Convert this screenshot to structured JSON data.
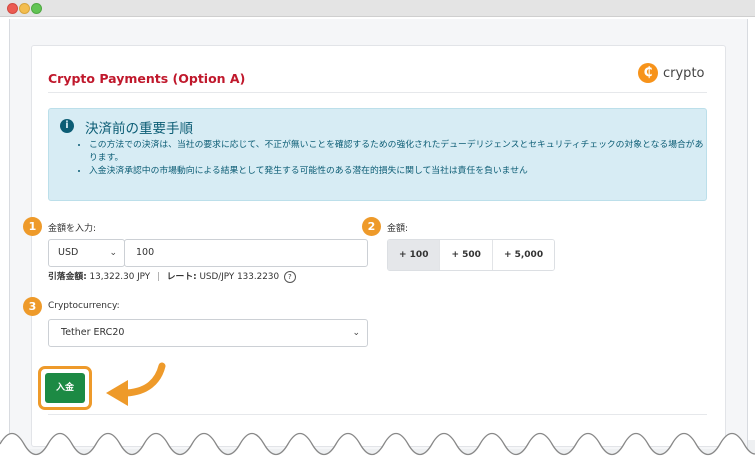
{
  "card": {
    "title": "Crypto Payments (Option A)",
    "brand": {
      "coin_glyph": "₵",
      "text": "crypto"
    }
  },
  "notice": {
    "title": "決済前の重要手順",
    "items": [
      "この方法での決済は、当社の要求に応じて、不正が無いことを確認するための強化されたデューデリジェンスとセキュリティチェックの対象となる場合があります。",
      "入金決済承認中の市場動向による結果として発生する可能性のある潜在的損失に関して当社は責任を負いません"
    ]
  },
  "step1": {
    "number": "1",
    "label": "金額を入力:",
    "currency": "USD",
    "amount": "100",
    "debit_label": "引落金額:",
    "debit_value": "13,322.30 JPY",
    "separator": "|",
    "rate_label": "レート:",
    "rate_value": "USD/JPY 133.2230",
    "help_glyph": "?"
  },
  "step2": {
    "number": "2",
    "label": "金額:",
    "buttons": [
      "+ 100",
      "+ 500",
      "+ 5,000"
    ]
  },
  "step3": {
    "number": "3",
    "label": "Cryptocurrency:",
    "selected": "Tether ERC20"
  },
  "deposit_button": "入金",
  "colors": {
    "title_red": "#c0182c",
    "accent_orange": "#ee9a2a",
    "deposit_green": "#1c8a44",
    "info_bg": "#d7ecf4",
    "info_text": "#0c5d75",
    "bitcoin_orange": "#f7931a"
  },
  "icons": {
    "info": "info-circle-icon",
    "brand": "crypto-coin-icon",
    "help": "question-circle-icon",
    "select": "chevron-down-icon",
    "pointer": "curved-arrow-icon"
  }
}
